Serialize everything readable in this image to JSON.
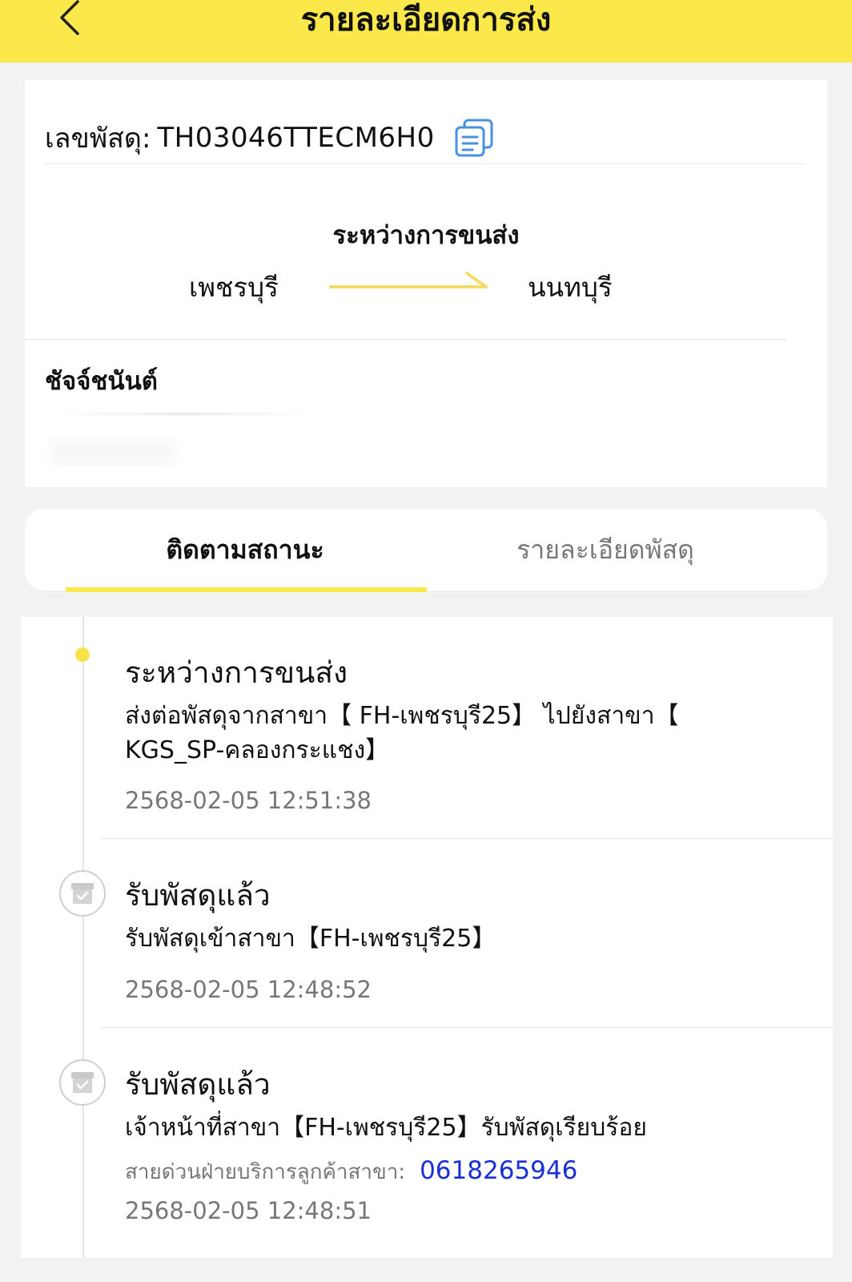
{
  "header": {
    "title": "รายละเอียดการส่ง",
    "back_icon": "chevron-left-icon",
    "background_color": "#fbe84a"
  },
  "parcel": {
    "tracking_label": "เลขพัสดุ:",
    "tracking_number": "TH03046TTECM6H0",
    "copy_icon": "copy-icon",
    "status": "ระหว่างการขนส่ง",
    "origin": "เพชรบุรี",
    "destination": "นนทบุรี",
    "recipient_name": "ชัจจ์ชนันต์"
  },
  "tabs": [
    {
      "label": "ติดตามสถานะ",
      "active": true
    },
    {
      "label": "รายละเอียดพัสดุ",
      "active": false
    }
  ],
  "timeline": [
    {
      "title": "ระหว่างการขนส่ง",
      "description": "ส่งต่อพัสดุจากสาขา【 FH-เพชรบุรี25】 ไปยังสาขา【 KGS_SP-คลองกระแชง】",
      "time": "2568-02-05 12:51:38"
    },
    {
      "title": "รับพัสดุแล้ว",
      "description": "รับพัสดุเข้าสาขา【FH-เพชรบุรี25】",
      "time": "2568-02-05 12:48:52",
      "icon": "package-check-icon"
    },
    {
      "title": "รับพัสดุแล้ว",
      "description": "เจ้าหน้าที่สาขา【FH-เพชรบุรี25】รับพัสดุเรียบร้อย",
      "hotline_label": "สายด่วนฝ่ายบริการลูกค้าสาขา:",
      "hotline_number": "0618265946",
      "time": "2568-02-05 12:48:51",
      "icon": "package-check-icon"
    }
  ],
  "colors": {
    "accent": "#fbe84a",
    "phone_link": "#1a2fd6",
    "copy_icon": "#4a90e2"
  }
}
